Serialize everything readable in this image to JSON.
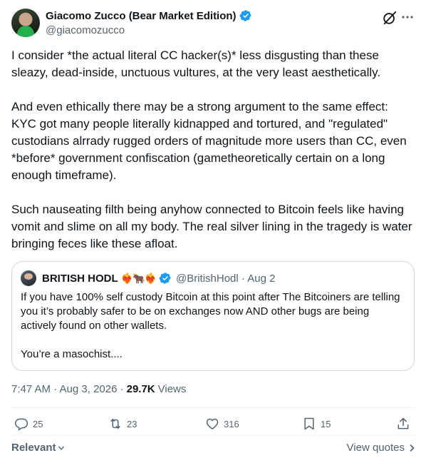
{
  "author": {
    "display_name": "Giacomo Zucco (Bear Market Edition)",
    "handle": "@giacomozucco"
  },
  "tweet": {
    "paragraphs": [
      "I consider *the actual literal CC hacker(s)* less disgusting than these sleazy, dead-inside, unctuous vultures, at the very least aesthetically.",
      "And even ethically there may be a strong argument to the same effect: KYC got many people literally kidnapped and tortured, and \"regulated\" custodians alrrady rugged orders of magnitude more users than CC, even *before* government confiscation (gametheoretically certain on a long enough timeframe).",
      "Such nauseating filth being anyhow connected to Bitcoin feels like having vomit and slime on all my body. The real silver lining in the tragedy is water bringing feces like these afloat."
    ]
  },
  "quote": {
    "display_name": "BRITISH HODL",
    "emoji": "❤️‍🔥🐂❤️‍🔥",
    "handle_date": "@BritishHodl · Aug 2",
    "paragraphs": [
      "If you have 100% self custody Bitcoin at this point after The Bitcoiners are telling you it’s probably safer to be on exchanges now AND other bugs are being actively found on other wallets.",
      "You’re a masochist...."
    ]
  },
  "meta": {
    "timestamp": "7:47 AM · Aug 3, 2026 ·",
    "views_count": "29.7K",
    "views_label": "Views"
  },
  "actions": {
    "replies": "25",
    "reposts": "23",
    "likes": "316",
    "bookmarks": "15"
  },
  "footer": {
    "sort_label": "Relevant",
    "view_quotes_label": "View quotes"
  },
  "colors": {
    "verified": "#1d9bf0",
    "secondary_text": "#536471",
    "primary_text": "#0f1419"
  }
}
